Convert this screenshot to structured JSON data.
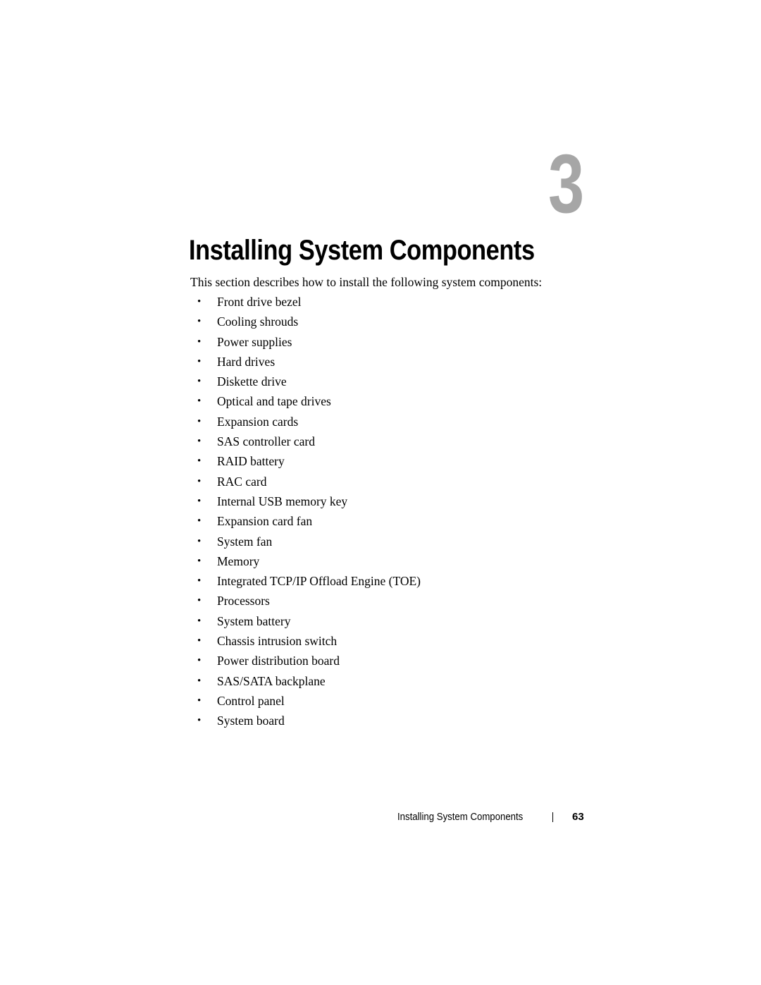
{
  "chapter": {
    "number": "3",
    "title": "Installing System Components"
  },
  "intro": "This section describes how to install the following system components:",
  "components": [
    "Front drive bezel",
    "Cooling shrouds",
    "Power supplies",
    "Hard drives",
    "Diskette drive",
    "Optical and tape drives",
    "Expansion cards",
    "SAS controller card",
    "RAID battery",
    "RAC card",
    "Internal USB memory key",
    "Expansion card fan",
    "System fan",
    "Memory",
    "Integrated TCP/IP Offload Engine (TOE)",
    "Processors",
    "System battery",
    "Chassis intrusion switch",
    "Power distribution board",
    "SAS/SATA backplane",
    "Control panel",
    "System board"
  ],
  "bullet_glyph": "•",
  "footer": {
    "section_title": "Installing System Components",
    "page_number": "63"
  },
  "colors": {
    "chapter_number": "#a6a6a6",
    "text": "#000000",
    "background": "#ffffff"
  }
}
